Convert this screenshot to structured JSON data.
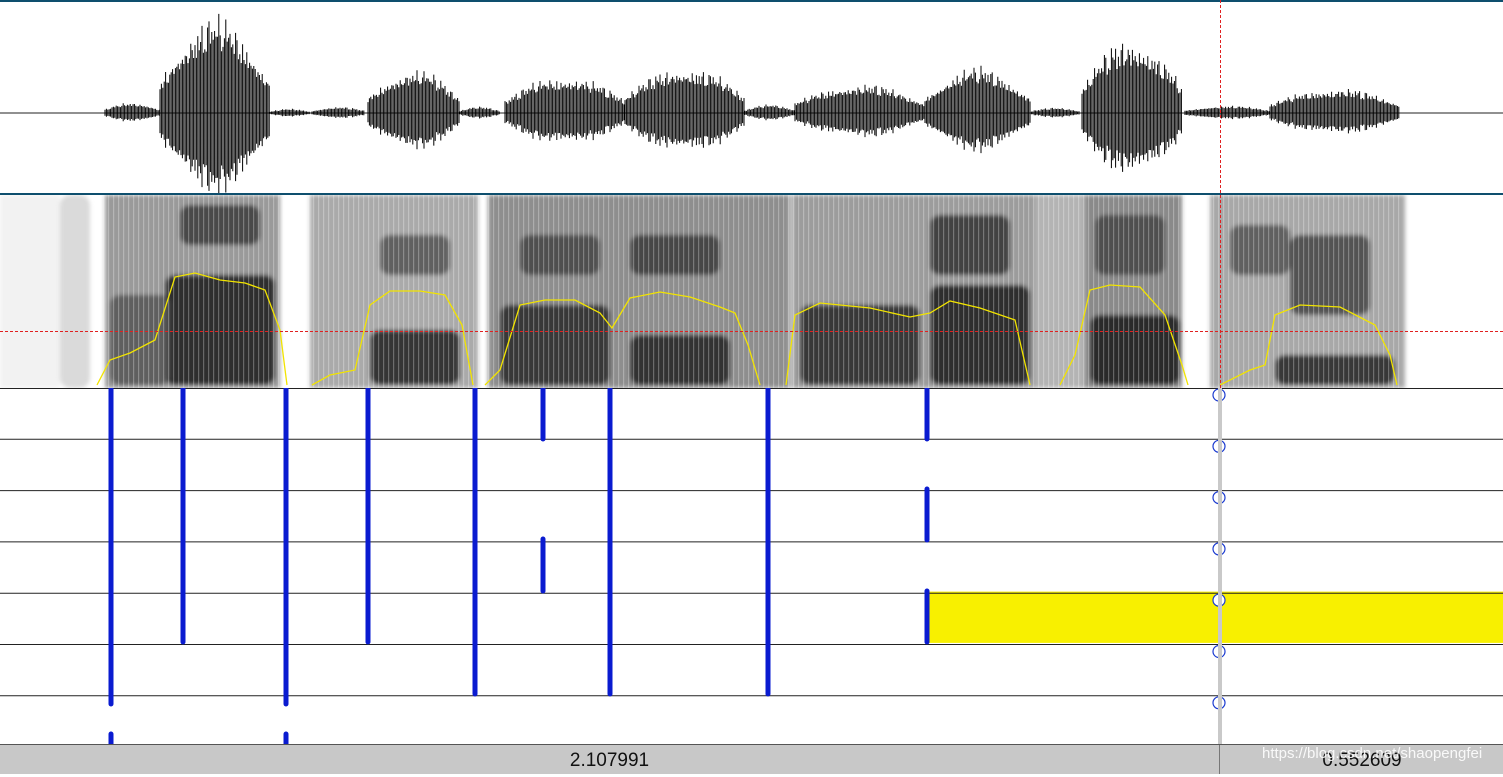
{
  "editor": {
    "selection_duration": "2.107991",
    "remaining_duration": "0.552609",
    "watermark": "https://blog.csdn.net/shaopengfei"
  },
  "colors": {
    "panel_border": "#0e4f6e",
    "cursor_red": "#e02020",
    "pitch_yellow": "#f2e400",
    "boundary_blue": "#0a1bd0",
    "highlight_yellow": "#f8f000",
    "statusbar_gray": "#c8c8c8"
  },
  "tiers": {
    "count": 7,
    "highlighted_tier": 3
  },
  "icons": [
    "boundary-circle-icon"
  ]
}
